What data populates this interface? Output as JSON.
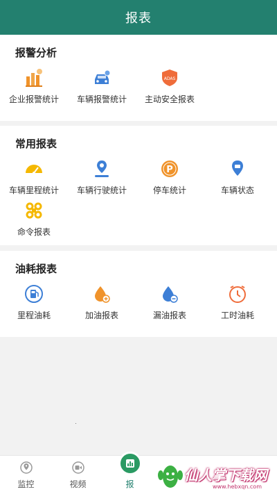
{
  "header": {
    "title": "报表"
  },
  "sections": [
    {
      "title": "报警分析",
      "items": [
        {
          "label": "企业报警统计",
          "icon": "building-bar-icon"
        },
        {
          "label": "车辆报警统计",
          "icon": "car-alarm-icon"
        },
        {
          "label": "主动安全报表",
          "icon": "adas-shield-icon"
        }
      ]
    },
    {
      "title": "常用报表",
      "items": [
        {
          "label": "车辆里程统计",
          "icon": "speedometer-icon"
        },
        {
          "label": "车辆行驶统计",
          "icon": "location-route-icon"
        },
        {
          "label": "停车统计",
          "icon": "parking-icon"
        },
        {
          "label": "车辆状态",
          "icon": "car-pin-icon"
        },
        {
          "label": "命令报表",
          "icon": "command-icon"
        }
      ]
    },
    {
      "title": "油耗报表",
      "items": [
        {
          "label": "里程油耗",
          "icon": "fuel-pump-icon"
        },
        {
          "label": "加油报表",
          "icon": "fuel-drop-plus-icon"
        },
        {
          "label": "漏油报表",
          "icon": "fuel-drop-minus-icon"
        },
        {
          "label": "工时油耗",
          "icon": "clock-timer-icon"
        }
      ]
    }
  ],
  "tabbar": {
    "tabs": [
      {
        "label": "监控",
        "icon": "monitor-pin-icon"
      },
      {
        "label": "视频",
        "icon": "video-icon"
      },
      {
        "label": "报",
        "icon": "report-icon",
        "active": true
      }
    ]
  },
  "watermark": {
    "text": "仙人掌下载网",
    "sub": "www.hebxqn.com"
  },
  "colors": {
    "header": "#23806f",
    "orange": "#f0932b",
    "blue": "#3d7fd6",
    "yellow": "#f5b800",
    "active_tab": "#2a9a63"
  }
}
